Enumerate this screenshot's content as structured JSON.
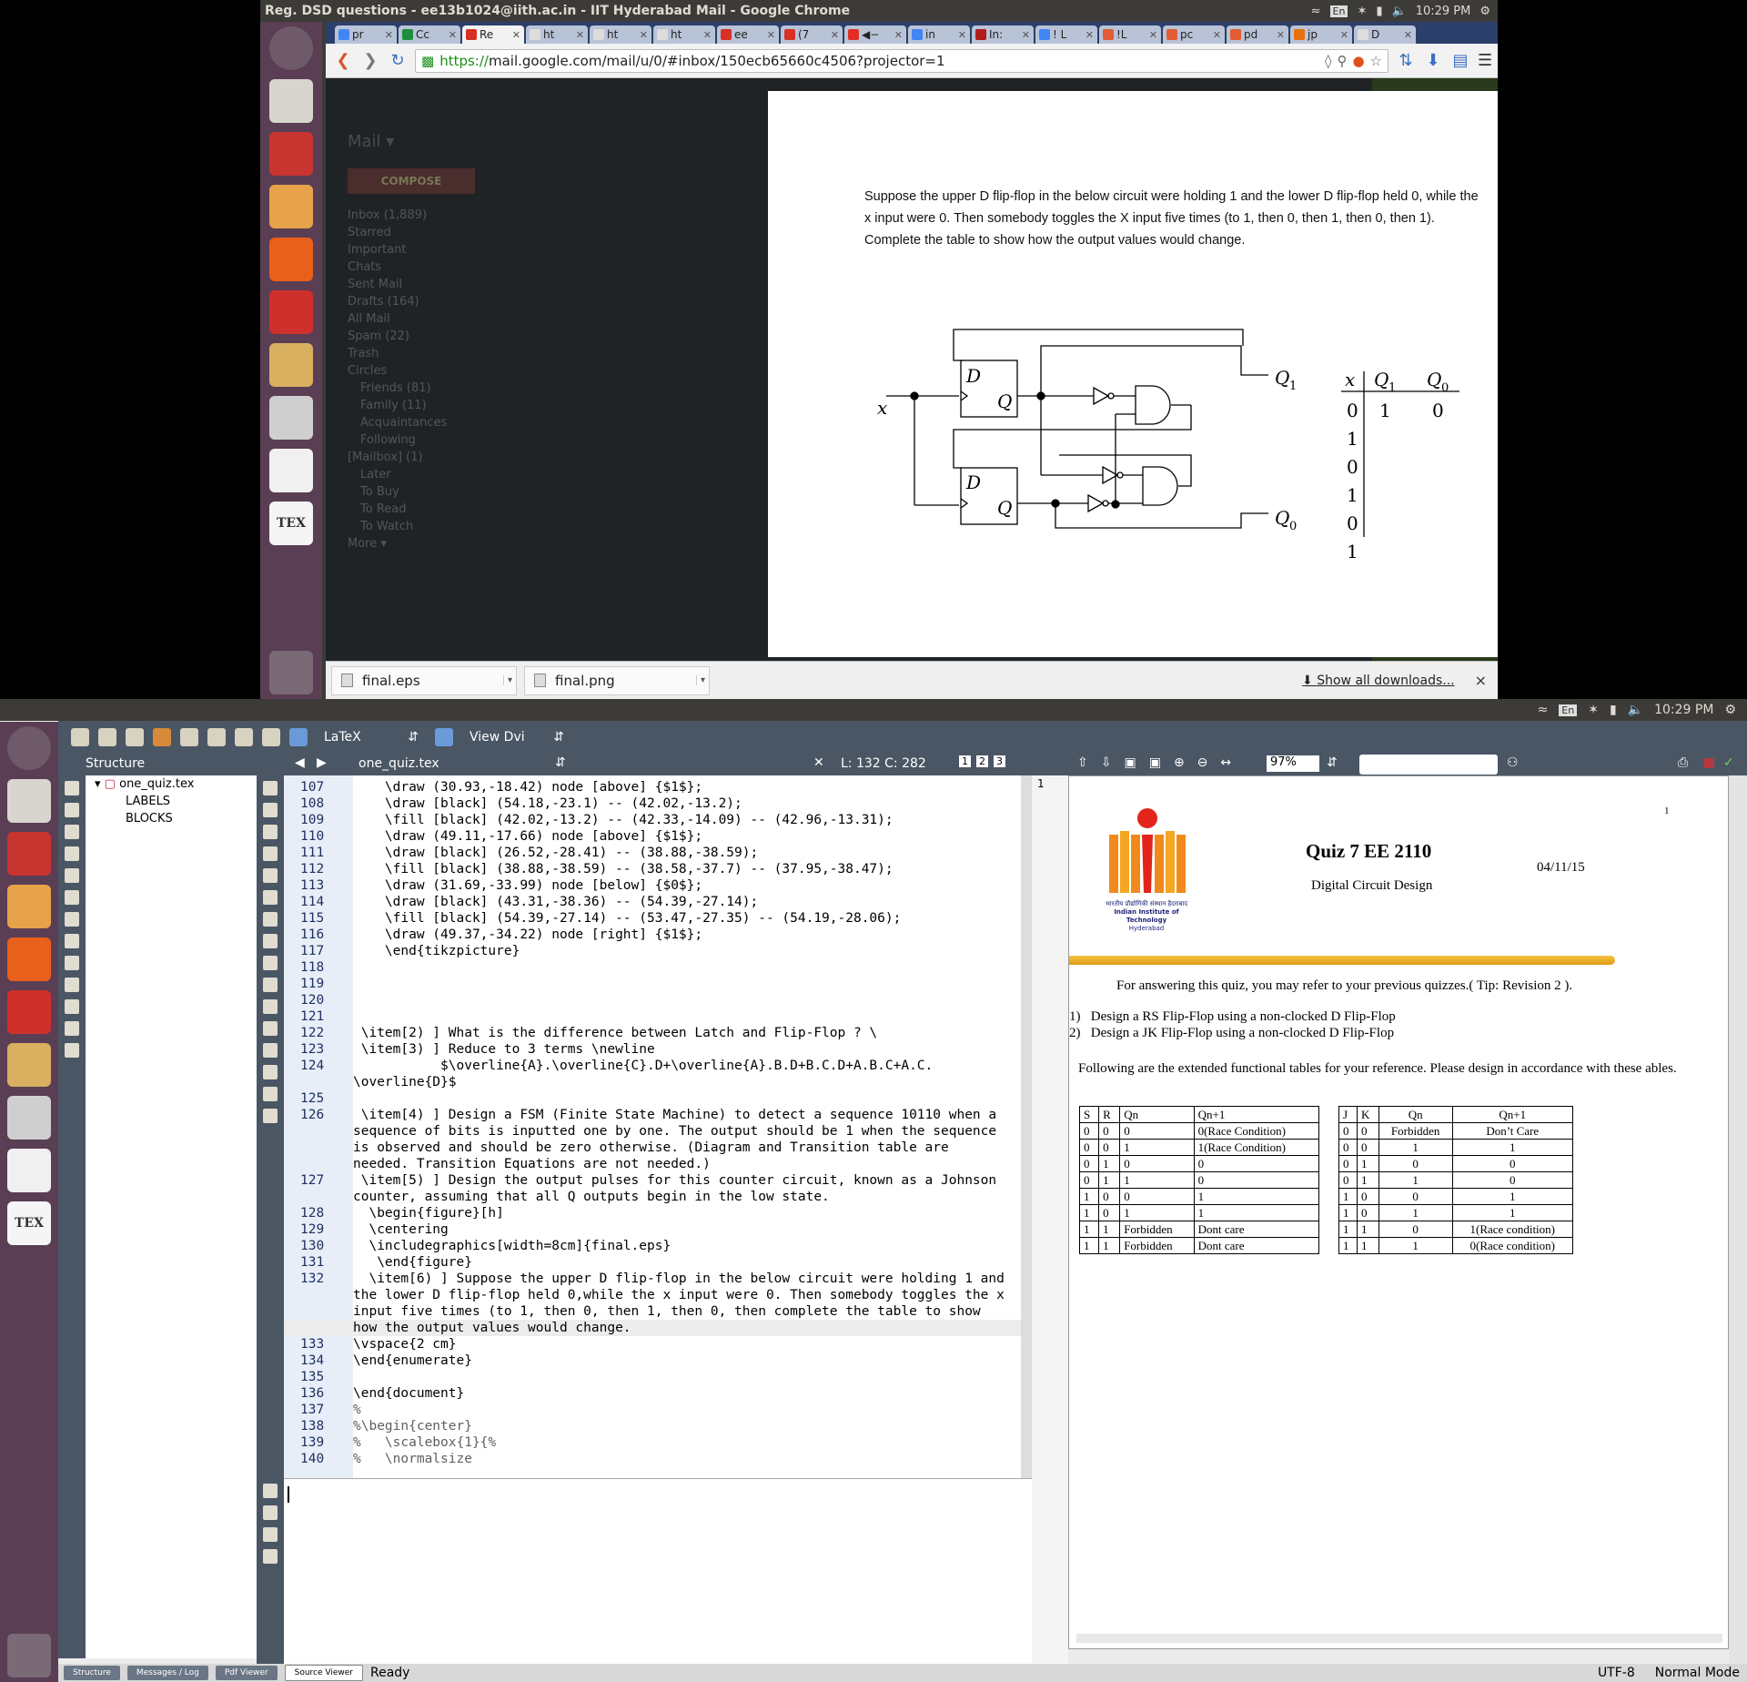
{
  "top": {
    "window_title": "Reg. DSD questions - ee13b1024@iith.ac.in - IIT Hyderabad Mail - Google Chrome",
    "clock": "10:29 PM",
    "lang": "En",
    "tabs": [
      "pr",
      "Cc",
      "Re",
      "ht",
      "ht",
      "ht",
      "ee",
      "(7",
      "◀−",
      "in",
      "In:",
      "! L",
      "!L",
      "pc",
      "pd",
      "jp",
      "D"
    ],
    "url_scheme": "https://",
    "url_rest": "mail.google.com/mail/u/0/#inbox/150ecb65660c4506?projector=1",
    "gmail_bg": [
      "Mail ▾",
      "COMPOSE",
      "Inbox (1,889)",
      "Starred",
      "Important",
      "Chats",
      "Sent Mail",
      "Drafts (164)",
      "All Mail",
      "Spam (22)",
      "Trash",
      "Circles",
      "Friends (81)",
      "Family (11)",
      "Acquaintances",
      "Following",
      "[Mailbox] (1)",
      "Later",
      "To Buy",
      "To Read",
      "To Watch",
      "More ▾"
    ],
    "problem": "Suppose the upper D flip-flop in the below circuit were holding 1 and the lower D flip-flop held 0, while the x  input were 0. Then somebody toggles the X input five times (to 1, then 0, then 1, then 0, then 1). Complete the table to show how the output values would change.",
    "circuit": {
      "x_label": "x",
      "ff_d": "D",
      "ff_q": "Q",
      "q1": "Q",
      "q1_sub": "1",
      "q0": "Q",
      "q0_sub": "0",
      "table_headers": [
        "x",
        "Q",
        "Q"
      ],
      "table_header_subs": [
        "",
        "1",
        "0"
      ],
      "x_values": [
        "0",
        "1",
        "0",
        "1",
        "0",
        "1"
      ],
      "first_q1": "1",
      "first_q0": "0"
    },
    "downloads": [
      "final.eps",
      "final.png"
    ],
    "show_all": "Show all downloads...",
    "close": "×"
  },
  "bottom": {
    "clock": "10:29 PM",
    "lang": "En",
    "toolbar": {
      "mode": "LaTeX",
      "view": "View Dvi"
    },
    "structure_title": "Structure",
    "file_tab": "one_quiz.tex",
    "line_col": "L: 132 C: 282",
    "zoom": "97%",
    "tree": [
      "one_quiz.tex",
      "LABELS",
      "BLOCKS"
    ],
    "code": [
      {
        "n": "107",
        "t": "    \\draw (30.93,-18.42) node [above] {$1$};"
      },
      {
        "n": "108",
        "t": "    \\draw [black] (54.18,-23.1) -- (42.02,-13.2);"
      },
      {
        "n": "109",
        "t": "    \\fill [black] (42.02,-13.2) -- (42.33,-14.09) -- (42.96,-13.31);"
      },
      {
        "n": "110",
        "t": "    \\draw (49.11,-17.66) node [above] {$1$};"
      },
      {
        "n": "111",
        "t": "    \\draw [black] (26.52,-28.41) -- (38.88,-38.59);"
      },
      {
        "n": "112",
        "t": "    \\fill [black] (38.88,-38.59) -- (38.58,-37.7) -- (37.95,-38.47);"
      },
      {
        "n": "113",
        "t": "    \\draw (31.69,-33.99) node [below] {$0$};"
      },
      {
        "n": "114",
        "t": "    \\draw [black] (43.31,-38.36) -- (54.39,-27.14);"
      },
      {
        "n": "115",
        "t": "    \\fill [black] (54.39,-27.14) -- (53.47,-27.35) -- (54.19,-28.06);"
      },
      {
        "n": "116",
        "t": "    \\draw (49.37,-34.22) node [right] {$1$};"
      },
      {
        "n": "117",
        "t": "    \\end{tikzpicture}"
      },
      {
        "n": "118",
        "t": ""
      },
      {
        "n": "119",
        "t": ""
      },
      {
        "n": "120",
        "t": ""
      },
      {
        "n": "121",
        "t": ""
      },
      {
        "n": "122",
        "t": " \\item[2) ] What is the difference between Latch and Flip-Flop ? \\"
      },
      {
        "n": "123",
        "t": " \\item[3) ] Reduce to 3 terms \\newline"
      },
      {
        "n": "124",
        "t": "           $\\overline{A}.\\overline{C}.D+\\overline{A}.B.D+B.C.D+A.B.C+A.C."
      },
      {
        "n": "",
        "t": "\\overline{D}$"
      },
      {
        "n": "125",
        "t": ""
      },
      {
        "n": "126",
        "t": " \\item[4) ] Design a FSM (Finite State Machine) to detect a sequence 10110 when a"
      },
      {
        "n": "",
        "t": "sequence of bits is inputted one by one. The output should be 1 when the sequence"
      },
      {
        "n": "",
        "t": "is observed and should be zero otherwise. (Diagram and Transition table are"
      },
      {
        "n": "",
        "t": "needed. Transition Equations are not needed.)"
      },
      {
        "n": "127",
        "t": " \\item[5) ] Design the output pulses for this counter circuit, known as a Johnson"
      },
      {
        "n": "",
        "t": "counter, assuming that all Q outputs begin in the low state."
      },
      {
        "n": "128",
        "t": "  \\begin{figure}[h]"
      },
      {
        "n": "129",
        "t": "  \\centering"
      },
      {
        "n": "130",
        "t": "  \\includegraphics[width=8cm]{final.eps}"
      },
      {
        "n": "131",
        "t": "   \\end{figure}"
      },
      {
        "n": "132",
        "t": "  \\item[6) ] Suppose the upper D flip-flop in the below circuit were holding 1 and"
      },
      {
        "n": "",
        "t": "the lower D flip-flop held 0,while the x input were 0. Then somebody toggles the x"
      },
      {
        "n": "",
        "t": "input five times (to 1, then 0, then 1, then 0, then complete the table to show"
      },
      {
        "n": "",
        "t": "how the output values would change."
      },
      {
        "n": "133",
        "t": "\\vspace{2 cm}"
      },
      {
        "n": "134",
        "t": "\\end{enumerate}"
      },
      {
        "n": "135",
        "t": ""
      },
      {
        "n": "136",
        "t": "\\end{document}"
      },
      {
        "n": "137",
        "t": "%"
      },
      {
        "n": "138",
        "t": "%\\begin{center}"
      },
      {
        "n": "139",
        "t": "%   \\scalebox{1}{%"
      },
      {
        "n": "140",
        "t": "%   \\normalsize"
      }
    ],
    "pdf": {
      "page_num": "1",
      "title": "Quiz 7  EE 2110",
      "date": "04/11/15",
      "subtitle": "Digital Circuit Design",
      "logo_text_1": "भारतीय प्रौद्योगिकी संस्थान हैदराबाद",
      "logo_text_2": "Indian Institute of Technology",
      "logo_text_3": "Hyderabad",
      "intro": "For answering this quiz, you may refer to your previous quizzes.( Tip: Revision 2 ).",
      "q1": "1)   Design a RS Flip-Flop using a non-clocked D Flip-Flop",
      "q2": "2)   Design a JK Flip-Flop using a non-clocked D Flip-Flop",
      "following": "Following are the extended functional tables for your reference. Please design in accordance with these ables.",
      "sr_table": [
        [
          "S",
          "R",
          "Qn",
          "Qn+1"
        ],
        [
          "0",
          "0",
          "0",
          "0(Race Condition)"
        ],
        [
          "0",
          "0",
          "1",
          "1(Race Condition)"
        ],
        [
          "0",
          "1",
          "0",
          "0"
        ],
        [
          "0",
          "1",
          "1",
          "0"
        ],
        [
          "1",
          "0",
          "0",
          "1"
        ],
        [
          "1",
          "0",
          "1",
          "1"
        ],
        [
          "1",
          "1",
          "Forbidden",
          "Dont care"
        ],
        [
          "1",
          "1",
          "Forbidden",
          "Dont care"
        ]
      ],
      "jk_table": [
        [
          "J",
          "K",
          "Qn",
          "Qn+1"
        ],
        [
          "0",
          "0",
          "Forbidden",
          "Don’t Care"
        ],
        [
          "0",
          "0",
          "1",
          "1"
        ],
        [
          "0",
          "1",
          "0",
          "0"
        ],
        [
          "0",
          "1",
          "1",
          "0"
        ],
        [
          "1",
          "0",
          "0",
          "1"
        ],
        [
          "1",
          "0",
          "1",
          "1"
        ],
        [
          "1",
          "1",
          "0",
          "1(Race condition)"
        ],
        [
          "1",
          "1",
          "1",
          "0(Race condition)"
        ]
      ]
    },
    "status": {
      "tabs": [
        "Structure",
        "Messages / Log",
        "Pdf Viewer",
        "Source Viewer"
      ],
      "ready": "Ready",
      "encoding": "UTF-8",
      "mode": "Normal Mode"
    }
  }
}
